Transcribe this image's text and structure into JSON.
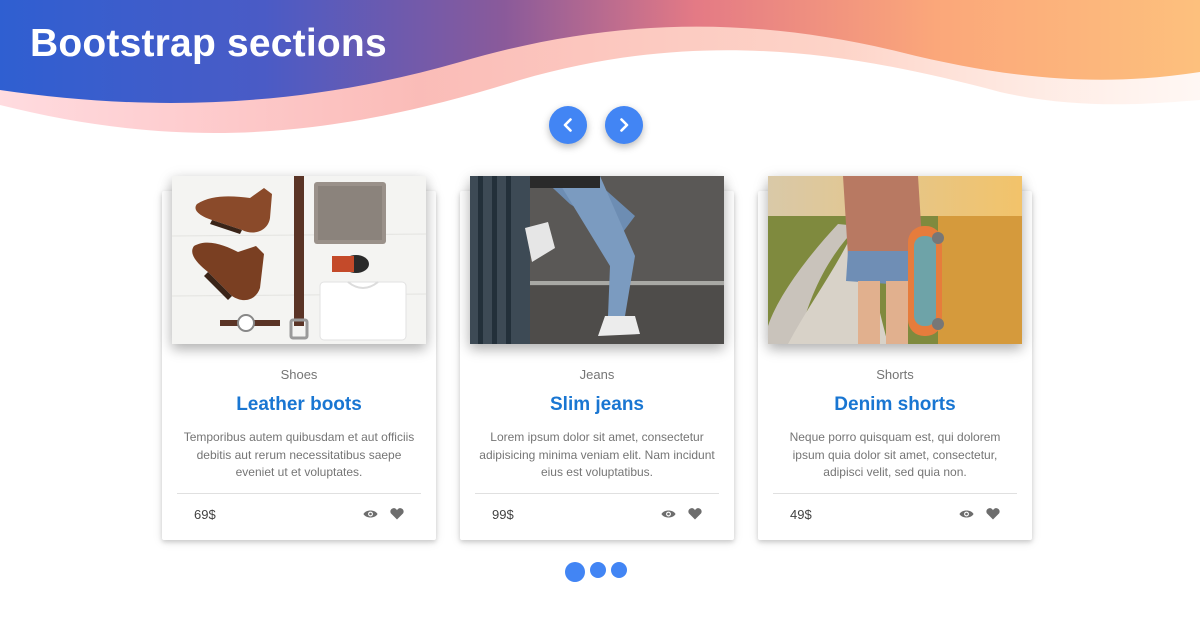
{
  "header": {
    "title": "Bootstrap sections"
  },
  "carousel": {
    "prev_icon": "chevron-left-icon",
    "next_icon": "chevron-right-icon",
    "active_slide": 1,
    "slide_count": 3
  },
  "cards": [
    {
      "image": "flat-lay-boots-belt-clothes-photo",
      "category": "Shoes",
      "title": "Leather boots",
      "description": "Temporibus autem quibusdam et aut officiis debitis aut rerum necessitatibus saepe eveniet ut et voluptates.",
      "price": "69$"
    },
    {
      "image": "person-in-jeans-sitting-photo",
      "category": "Jeans",
      "title": "Slim jeans",
      "description": "Lorem ipsum dolor sit amet, consectetur adipisicing minima veniam elit. Nam incidunt eius est voluptatibus.",
      "price": "99$"
    },
    {
      "image": "skateboard-girl-on-road-photo",
      "category": "Shorts",
      "title": "Denim shorts",
      "description": "Neque porro quisquam est, qui dolorem ipsum quia dolor sit amet, consectetur, adipisci velit, sed quia non.",
      "price": "49$"
    }
  ],
  "colors": {
    "accent": "#4285f4",
    "title_blue": "#1976d2",
    "muted_text": "#757575"
  }
}
